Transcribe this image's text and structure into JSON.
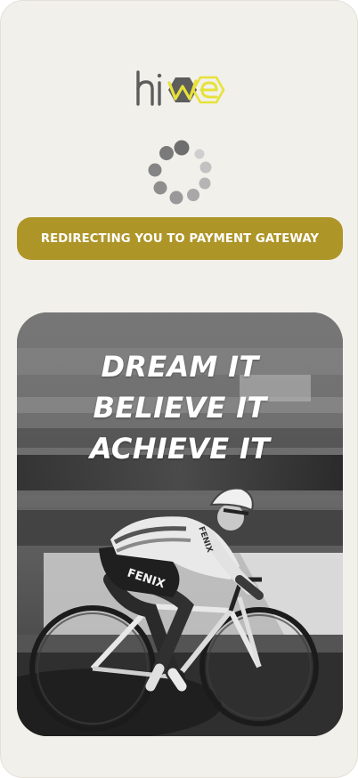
{
  "brand": {
    "logo_text_left": "hi",
    "logo_text_right": "we",
    "accent": "#e6e23a",
    "dark": "#5d5d5d"
  },
  "status": {
    "message": "REDIRECTING YOU TO PAYMENT GATEWAY",
    "color": "#ae9528"
  },
  "spinner": {
    "icon": "loading-spinner-icon"
  },
  "hero": {
    "lines": [
      "DREAM IT",
      "BELIEVE IT",
      "ACHIEVE IT"
    ],
    "jersey_text_chest": "FENIX",
    "jersey_text_side": "FENIX"
  }
}
